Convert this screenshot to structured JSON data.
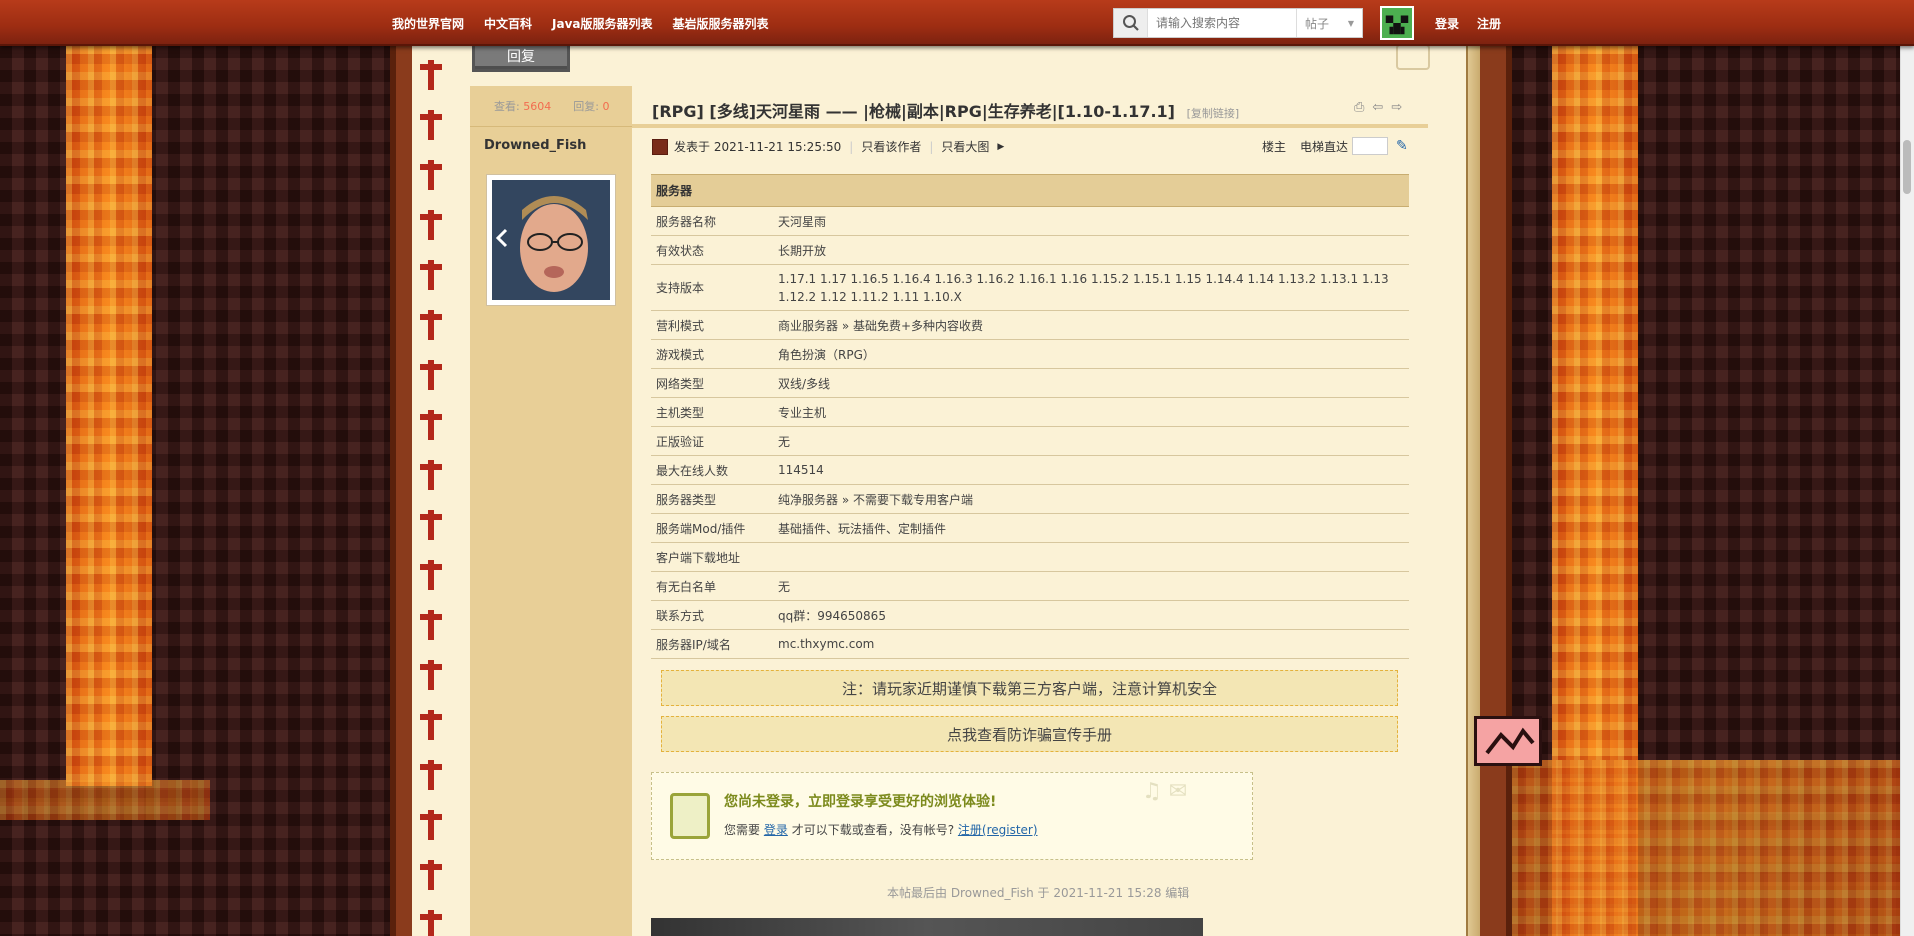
{
  "nav": {
    "links": [
      "我的世界官网",
      "中文百科",
      "Java版服务器列表",
      "基岩版服务器列表"
    ],
    "search_placeholder": "请输入搜索内容",
    "search_type": "帖子",
    "login": "登录",
    "register": "注册"
  },
  "post": {
    "reply_label": "回复",
    "views_label": "查看:",
    "views": "5604",
    "replies_label": "回复:",
    "replies": "0",
    "author": "Drowned_Fish",
    "title": "[RPG] [多线]天河星雨 —— |枪械|副本|RPG|生存养老|[1.10-1.17.1]",
    "copy_link": "[复制链接]",
    "posted_at": "发表于 2021-11-21 15:25:50",
    "only_author": "只看该作者",
    "only_big_image": "只看大图",
    "floor": "楼主",
    "elevator": "电梯直达"
  },
  "server": {
    "header": "服务器",
    "rows": [
      {
        "k": "服务器名称",
        "v": "天河星雨"
      },
      {
        "k": "有效状态",
        "v": "长期开放"
      },
      {
        "k": "支持版本",
        "v": "1.17.1 1.17 1.16.5 1.16.4 1.16.3 1.16.2 1.16.1 1.16 1.15.2 1.15.1 1.15 1.14.4 1.14 1.13.2 1.13.1 1.13 1.12.2 1.12 1.11.2 1.11 1.10.X"
      },
      {
        "k": "营利模式",
        "v": "商业服务器 » 基础免费+多种内容收费"
      },
      {
        "k": "游戏模式",
        "v": "角色扮演（RPG）"
      },
      {
        "k": "网络类型",
        "v": "双线/多线"
      },
      {
        "k": "主机类型",
        "v": "专业主机"
      },
      {
        "k": "正版验证",
        "v": "无"
      },
      {
        "k": "最大在线人数",
        "v": "114514"
      },
      {
        "k": "服务器类型",
        "v": "纯净服务器 » 不需要下载专用客户端"
      },
      {
        "k": "服务端Mod/插件",
        "v": "基础插件、玩法插件、定制插件"
      },
      {
        "k": "客户端下载地址",
        "v": ""
      },
      {
        "k": "有无白名单",
        "v": "无"
      },
      {
        "k": "联系方式",
        "v": "qq群：994650865"
      },
      {
        "k": "服务器IP/域名",
        "v": "mc.thxymc.com"
      }
    ]
  },
  "notices": {
    "warning": "注：请玩家近期谨慎下载第三方客户端，注意计算机安全",
    "anti_fraud": "点我查看防诈骗宣传手册"
  },
  "login_prompt": {
    "title": "您尚未登录，立即登录享受更好的浏览体验!",
    "need": "您需要",
    "login_link": "登录",
    "middle": "才可以下载或查看，没有帐号?",
    "register_link": "注册(register)"
  },
  "edited_note": "本帖最后由 Drowned_Fish 于 2021-11-21 15:28 编辑"
}
